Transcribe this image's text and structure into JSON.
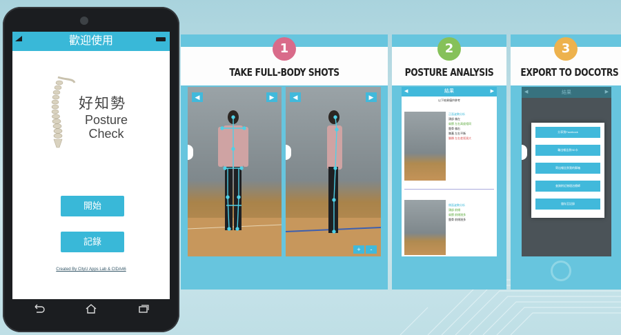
{
  "colors": {
    "accent": "#39b8d8",
    "panel": "#67c5de",
    "step1": "#d96b8a",
    "step2": "#86c15a",
    "step3": "#edb24d"
  },
  "phone": {
    "header_title": "歡迎使用",
    "logo_cn": "好知勢",
    "logo_en_line1": "Posture",
    "logo_en_line2": "Check",
    "start_label": "開始",
    "record_label": "記錄",
    "credit": "Created By CityU Apps Lab & CIDA46",
    "icons": [
      "signal-icon",
      "battery-icon",
      "spine-icon",
      "back-icon",
      "home-icon",
      "recent-apps-icon"
    ]
  },
  "steps": [
    {
      "number": "1",
      "title": "TAKE FULL-BODY SHOTS"
    },
    {
      "number": "2",
      "title": "POSTURE ANALYSIS"
    },
    {
      "number": "3",
      "title": "EXPORT TO DOCOTRS"
    }
  ],
  "photo_controls": {
    "prev": "◀",
    "next": "▶",
    "zoom_in": "+",
    "zoom_out": "-"
  },
  "analysis": {
    "title": "結果",
    "subtitle": "以下結果僅供參考",
    "block1": [
      "正面姿勢分析",
      "頭部 偏左",
      "肩膀 左右高度相同",
      "盤骨 偏右",
      "膝蓋 左右平衡",
      "腳踝 左右差距過大"
    ],
    "block2": [
      "側面姿勢分析",
      "頭部 前傾",
      "肩膀 前傾過多",
      "盤骨 前傾過多"
    ]
  },
  "export": {
    "title": "結果",
    "options": [
      "分享到Facebook",
      "輸出報告到SD卡",
      "寄出報告到我的郵箱",
      "查詢附近物理治療師",
      "儲存至記錄"
    ]
  }
}
